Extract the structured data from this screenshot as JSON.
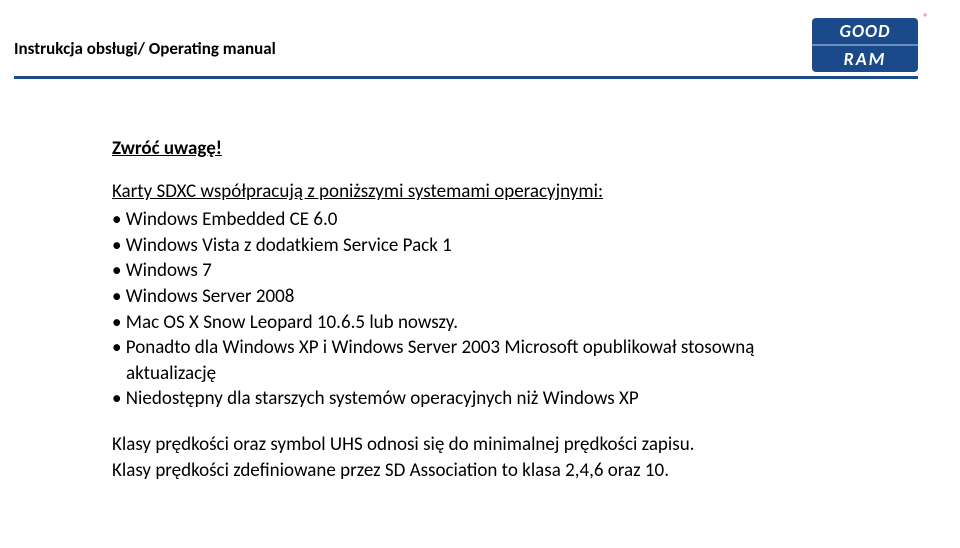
{
  "header": {
    "title": "Instrukcja obsługi/ Operating manual",
    "logo_top": "GOOD",
    "logo_bottom": "RAM",
    "logo_reg": "®"
  },
  "content": {
    "attention": "Zwróć uwagę!",
    "intro": "Karty SDXC współpracują z poniższymi systemami operacyjnymi:",
    "bullets": [
      "• Windows Embedded CE 6.0",
      "• Windows Vista z dodatkiem Service Pack 1",
      "• Windows 7",
      "• Windows Server 2008",
      "• Mac OS X Snow Leopard 10.6.5 lub nowszy.",
      "• Ponadto dla Windows XP i Windows Server 2003 Microsoft opublikował stosowną"
    ],
    "bullet_sub": "aktualizację",
    "bullet_last": "• Niedostępny dla starszych systemów operacyjnych niż Windows XP",
    "para1": "Klasy prędkości oraz symbol UHS odnosi się do minimalnej prędkości zapisu.",
    "para2": "Klasy prędkości zdefiniowane przez SD Association to klasa 2,4,6 oraz 10."
  }
}
